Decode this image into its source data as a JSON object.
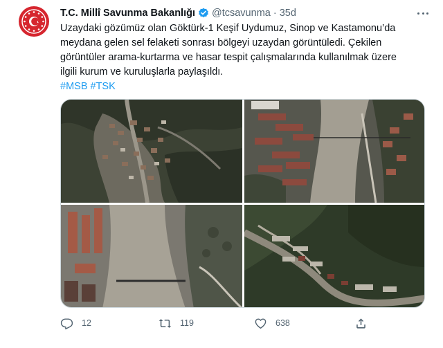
{
  "tweet": {
    "author_name": "T.C. Millî Savunma Bakanlığı",
    "handle": "@tcsavunma",
    "separator": "·",
    "time": "35d",
    "text_lines": [
      "Uzaydaki gözümüz olan Göktürk-1 Keşif Uydumuz, Sinop ve Kastamonu’da",
      "meydana gelen sel felaketi sonrası bölgeyi uzaydan görüntüledi. Çekilen",
      "görüntüler arama-kurtarma ve hasar tespit çalışmalarında kullanılmak üzere",
      "ilgili kurum ve kuruluşlarla paylaşıldı."
    ],
    "hashtags": [
      "#MSB",
      "#TSK"
    ],
    "media": [
      {
        "description": "satellite-image-1"
      },
      {
        "description": "satellite-image-2"
      },
      {
        "description": "satellite-image-3"
      },
      {
        "description": "satellite-image-4"
      }
    ],
    "stats": {
      "replies": "12",
      "retweets": "119",
      "likes": "638"
    },
    "colors": {
      "accent": "#1d9bf0",
      "secondary_text": "#536471",
      "avatar_bg": "#d6262f"
    },
    "icons": {
      "reply": "reply-icon",
      "retweet": "retweet-icon",
      "like": "heart-icon",
      "share": "share-icon",
      "verified": "verified-badge-icon",
      "more": "more-icon"
    }
  }
}
